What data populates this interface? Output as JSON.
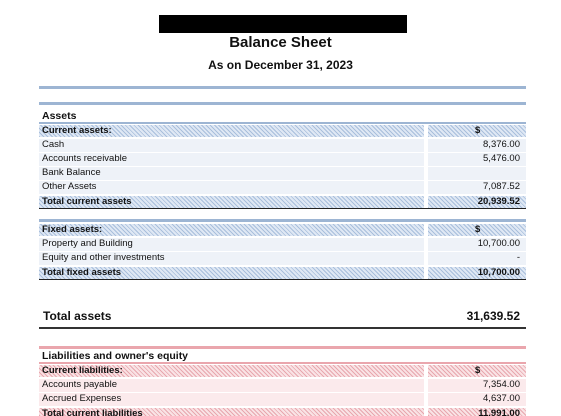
{
  "header": {
    "title": "Balance Sheet",
    "subtitle": "As on December 31, 2023"
  },
  "assets": {
    "heading": "Assets",
    "current": {
      "label": "Current assets:",
      "currency": "$",
      "items": [
        {
          "label": "Cash",
          "value": "8,376.00"
        },
        {
          "label": "Accounts receivable",
          "value": "5,476.00"
        },
        {
          "label": "Bank Balance",
          "value": ""
        },
        {
          "label": "Other Assets",
          "value": "7,087.52"
        }
      ],
      "total_label": "Total current assets",
      "total_value": "20,939.52"
    },
    "fixed": {
      "label": "Fixed assets:",
      "currency": "$",
      "items": [
        {
          "label": "Property and Building",
          "value": "10,700.00"
        },
        {
          "label": "Equity and other investments",
          "value": "-"
        }
      ],
      "total_label": "Total fixed assets",
      "total_value": "10,700.00"
    },
    "total_label": "Total assets",
    "total_value": "31,639.52"
  },
  "liabilities": {
    "heading": "Liabilities and owner's equity",
    "current": {
      "label": "Current liabilities:",
      "currency": "$",
      "items": [
        {
          "label": "Accounts payable",
          "value": "7,354.00"
        },
        {
          "label": "Accrued Expenses",
          "value": "4,637.00"
        }
      ],
      "total_label": "Total current liabilities",
      "total_value": "11,991.00"
    }
  }
}
